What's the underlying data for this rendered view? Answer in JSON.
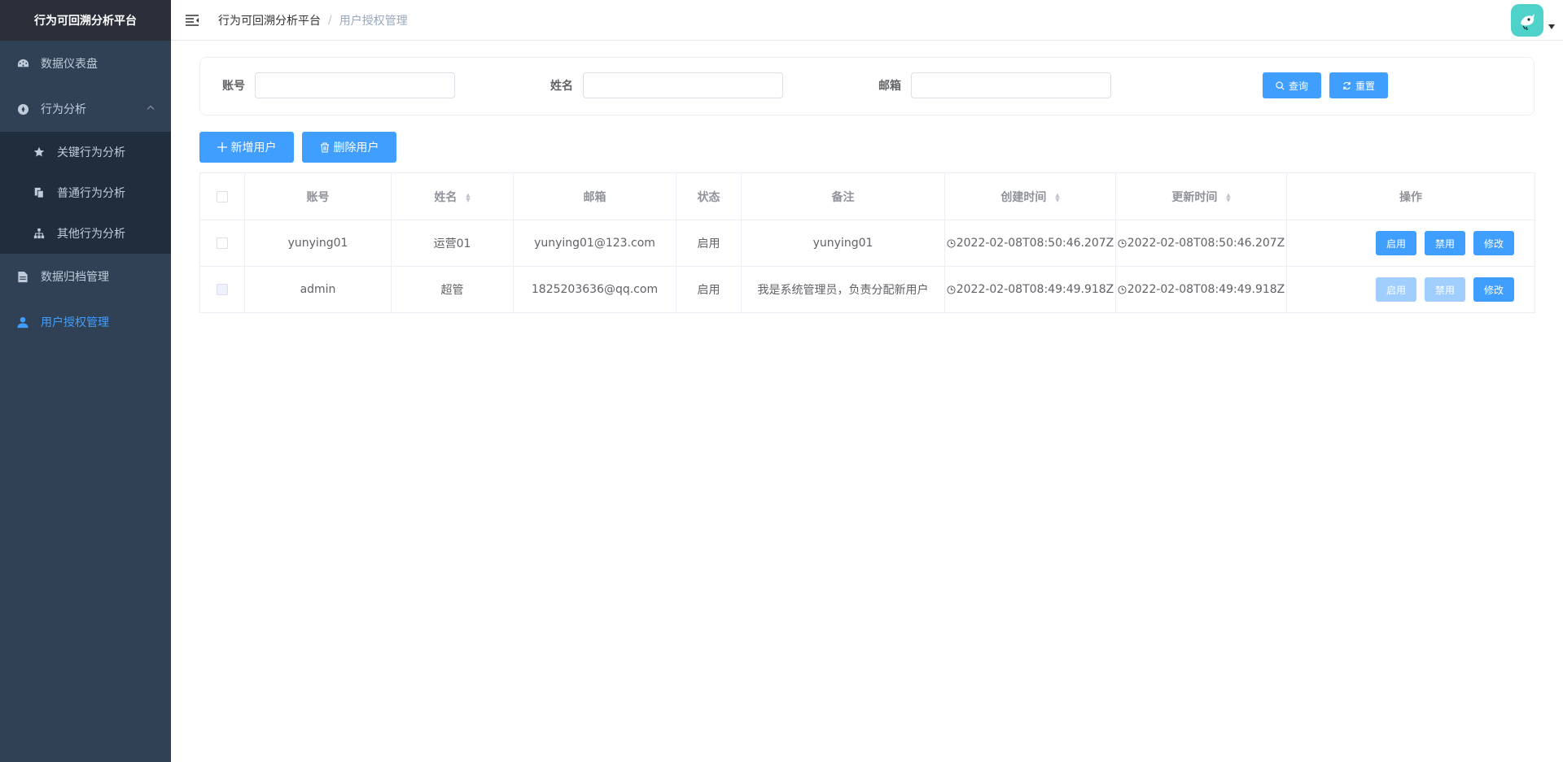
{
  "app": {
    "title": "行为可回溯分析平台"
  },
  "sidebar": {
    "items": [
      {
        "label": "数据仪表盘",
        "icon": "dashboard-icon"
      },
      {
        "label": "行为分析",
        "icon": "compass-icon",
        "children": [
          {
            "label": "关键行为分析",
            "icon": "star-icon"
          },
          {
            "label": "普通行为分析",
            "icon": "copy-icon"
          },
          {
            "label": "其他行为分析",
            "icon": "tree-icon"
          }
        ]
      },
      {
        "label": "数据归档管理",
        "icon": "document-icon"
      },
      {
        "label": "用户授权管理",
        "icon": "user-icon"
      }
    ]
  },
  "header": {
    "breadcrumb": [
      "行为可回溯分析平台",
      "用户授权管理"
    ],
    "separator": "/"
  },
  "search": {
    "account_label": "账号",
    "name_label": "姓名",
    "email_label": "邮箱",
    "account_value": "",
    "name_value": "",
    "email_value": "",
    "query_label": "查询",
    "reset_label": "重置"
  },
  "toolbar": {
    "add_label": "新增用户",
    "delete_label": "删除用户"
  },
  "table": {
    "columns": [
      "账号",
      "姓名",
      "邮箱",
      "状态",
      "备注",
      "创建时间",
      "更新时间",
      "操作"
    ],
    "rows": [
      {
        "account": "yunying01",
        "name": "运营01",
        "email": "yunying01@123.com",
        "status": "启用",
        "remark": "yunying01",
        "created": "2022-02-08T08:50:46.207Z",
        "updated": "2022-02-08T08:50:46.207Z",
        "actions_disabled": false
      },
      {
        "account": "admin",
        "name": "超管",
        "email": "1825203636@qq.com",
        "status": "启用",
        "remark": "我是系统管理员，负责分配新用户",
        "created": "2022-02-08T08:49:49.918Z",
        "updated": "2022-02-08T08:49:49.918Z",
        "actions_disabled": true
      }
    ],
    "action_enable": "启用",
    "action_disable": "禁用",
    "action_edit": "修改"
  },
  "colors": {
    "sidebar_bg": "#304156",
    "logo_bg": "#2b2f3a",
    "submenu_bg": "#1f2d3d",
    "primary": "#409eff",
    "primary_disabled": "#a0cfff",
    "avatar_bg": "#4fd2c9"
  }
}
